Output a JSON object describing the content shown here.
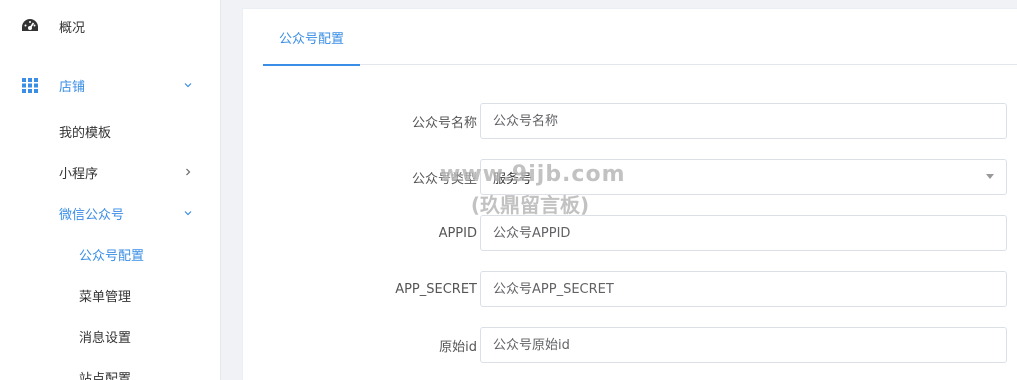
{
  "sidebar": {
    "overview": {
      "label": "概况",
      "icon": "dashboard-icon"
    },
    "store": {
      "label": "店铺",
      "icon": "grid-icon",
      "expanded": true
    },
    "items": [
      {
        "label": "我的模板"
      },
      {
        "label": "小程序"
      },
      {
        "label": "微信公众号"
      },
      {
        "label": "公众号配置"
      },
      {
        "label": "菜单管理"
      },
      {
        "label": "消息设置"
      },
      {
        "label": "站点配置"
      }
    ]
  },
  "main": {
    "tab_label": "公众号配置",
    "form": {
      "name": {
        "label": "公众号名称",
        "placeholder": "公众号名称"
      },
      "type": {
        "label": "公众号类型",
        "value": "服务号"
      },
      "appid": {
        "label": "APPID",
        "placeholder": "公众号APPID"
      },
      "secret": {
        "label": "APP_SECRET",
        "placeholder": "公众号APP_SECRET"
      },
      "origin": {
        "label": "原始id",
        "placeholder": "公众号原始id"
      }
    }
  },
  "watermark": {
    "line1": "www.9ijb.com",
    "line2": "(玖鼎留言板)"
  },
  "colors": {
    "accent": "#3a8ee6",
    "sidebar_bg": "#ffffff",
    "page_bg": "#f0f2f5"
  }
}
